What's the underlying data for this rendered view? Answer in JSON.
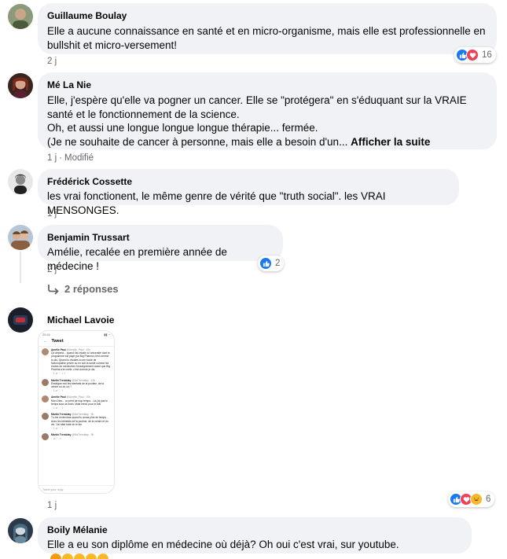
{
  "comments": [
    {
      "author": "Guillaume Boulay",
      "text": "Elle a aucune connaissance en santé et en micro-organisme, mais elle est professionnelle en bullshit et micro-versement!",
      "time": "2 j",
      "reactions_count": "16"
    },
    {
      "author": "Mé La Nie",
      "lines": [
        "Elle, j'espère qu'elle va pogner un cancer. Elle se \"protégera\" en s'éduquant sur la VRAIE santé et le fonctionnement de la science.",
        "Oh, et aussi une longue longue longue thérapie... fermée.",
        "(Je ne souhaite de cancer à personne, mais elle a besoin d'un..."
      ],
      "see_more": "Afficher la suite",
      "time": "1 j",
      "edited": "Modifié"
    },
    {
      "author": "Frédérick Cossette",
      "text": "les vrai fonctionent, le même genre de vérité que \"truth social\". les VRAI MENSONGES.",
      "time": "1 j"
    },
    {
      "author": "Benjamin Trussart",
      "text": "Amélie, recalée en première année de médecine !",
      "time": "2 j",
      "reactions_count": "2",
      "replies": "2 réponses"
    },
    {
      "author": "Michael Lavoie",
      "time": "1 j",
      "reactions_count": "6"
    },
    {
      "author": "Boily Mélanie",
      "text": "Elle a eu son diplôme en médecine où déjà? Oh oui c'est vrai, sur youtube."
    }
  ],
  "attachment": {
    "header": "Tweet",
    "status_time": "20:41",
    "tweets": [
      {
        "name": "Amélie Paul",
        "handle": "@Amelie_Paul · 10h",
        "text": "Ça dépend... quand t'as étudié à l'université dont le programme est payé par Big Pharma c'est comme tu dis. Quand tu étudies à une école de Naturopathie privée ou en soit la santé comme les écoles de médecines l'enseignement avant que Big Pharma s'en mêle, c'est comme je dis."
      },
      {
        "name": "Martin Tremblay",
        "handle": "@MaTremblay · 10h",
        "text": "Enseigne moi les bienfaits de la poutine, de la ventre ou du vin ?"
      },
      {
        "name": "Amélie Paul",
        "handle": "@Amelie_Paul · 10h",
        "text": "Mon Dieu... on perd de trop temps... Là j'ai pas le temps sous la main. Mais merci pour le talk"
      },
      {
        "name": "Martin Tremblay",
        "handle": "@MaTremblay · 9h",
        "text": "Tu me reviendras quand tu auras plus de temps... Avec les bienfaits de la poutine, de la ventre et du vin. J'ai hâte hâte de te lire."
      },
      {
        "name": "Martin Tremblay",
        "handle": "@MaTremblay · 9h",
        "text": ""
      }
    ],
    "reply_placeholder": "Tweet your reply"
  }
}
